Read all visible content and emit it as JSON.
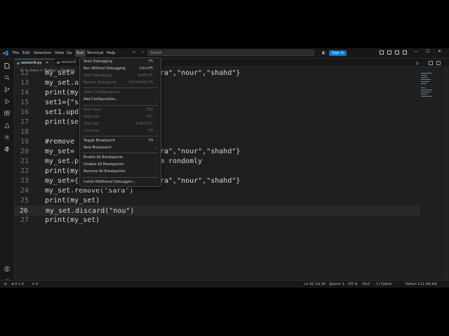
{
  "menubar": {
    "items": [
      "File",
      "Edit",
      "Selection",
      "View",
      "Go",
      "Run",
      "Terminal",
      "Help"
    ],
    "active": "Run"
  },
  "titlebar": {
    "back": "←",
    "forward": "→",
    "search_placeholder": "Search",
    "signin": "Sign in",
    "minimize": "—",
    "maximize": "☐",
    "close": "✕"
  },
  "tabs": [
    {
      "label": "session6.py",
      "close": "✕",
      "active": true
    },
    {
      "label": "session5",
      "close": "",
      "active": false
    }
  ],
  "breadcrumb": "C: > Users > Mokka > Desktop",
  "code_lines": [
    {
      "num": "12",
      "text": "my_set=",
      "tail": "ra\",\"nour\",\"shahd\"}"
    },
    {
      "num": "13",
      "text": "my_set.a",
      "tail": ""
    },
    {
      "num": "14",
      "text": "print(my",
      "tail": ""
    },
    {
      "num": "15",
      "text": "set1={\"s",
      "tail": ""
    },
    {
      "num": "16",
      "text": "set1.upd",
      "tail": ""
    },
    {
      "num": "17",
      "text": "print(se",
      "tail": ""
    },
    {
      "num": "18",
      "text": "",
      "tail": ""
    },
    {
      "num": "19",
      "text": "#remove",
      "tail": ""
    },
    {
      "num": "20",
      "text": "my_set=",
      "tail": "ra\",\"nour\",\"shahd\"}"
    },
    {
      "num": "21",
      "text": "my_set.p",
      "tail": "m rondomly"
    },
    {
      "num": "22",
      "text": "print(my",
      "tail": ""
    },
    {
      "num": "23",
      "text": "my_set={",
      "tail": "ra\",\"nour\",\"shahd\"}"
    },
    {
      "num": "24",
      "text": "my_set.remove(\"sara\")",
      "tail": ""
    },
    {
      "num": "25",
      "text": "print(my_set)",
      "tail": ""
    },
    {
      "num": "26",
      "text": "my_set.discard(\"nou\")",
      "tail": ""
    },
    {
      "num": "27",
      "text": "print(my_set)",
      "tail": ""
    }
  ],
  "run_menu": {
    "items": [
      {
        "label": "Start Debugging",
        "shortcut": "F5",
        "disabled": false
      },
      {
        "label": "Run Without Debugging",
        "shortcut": "Ctrl+F5",
        "disabled": false
      },
      {
        "label": "Stop Debugging",
        "shortcut": "Shift+F5",
        "disabled": true
      },
      {
        "label": "Restart Debugging",
        "shortcut": "Ctrl+Shift+F5",
        "disabled": true
      },
      {
        "label": "Open Configurations",
        "shortcut": "",
        "disabled": true
      },
      {
        "label": "Add Configuration...",
        "shortcut": "",
        "disabled": false
      },
      {
        "label": "Step Over",
        "shortcut": "F10",
        "disabled": true
      },
      {
        "label": "Step Into",
        "shortcut": "F11",
        "disabled": true
      },
      {
        "label": "Step Out",
        "shortcut": "Shift+F11",
        "disabled": true
      },
      {
        "label": "Continue",
        "shortcut": "F5",
        "disabled": true
      },
      {
        "label": "Toggle Breakpoint",
        "shortcut": "F9",
        "disabled": false
      },
      {
        "label": "New Breakpoint",
        "shortcut": "",
        "disabled": false,
        "submenu_arrow": "›"
      },
      {
        "label": "Enable All Breakpoints",
        "shortcut": "",
        "disabled": false
      },
      {
        "label": "Disable All Breakpoints",
        "shortcut": "",
        "disabled": false
      },
      {
        "label": "Remove All Breakpoints",
        "shortcut": "",
        "disabled": false
      },
      {
        "label": "Install Additional Debuggers...",
        "shortcut": "",
        "disabled": false
      }
    ]
  },
  "statusbar": {
    "remote": "⇄",
    "problems": "⊗ 0 ⚠ 0",
    "ports": "⊳ 0",
    "position": "Ln 26, Col 20",
    "spaces": "Spaces: 4",
    "encoding": "UTF-8",
    "eol": "CRLF",
    "language": "{} Python",
    "interpreter": "Python 3.11 (64-bit)"
  },
  "colors": {
    "accent": "#0078d4",
    "background": "#1f1f1f"
  }
}
